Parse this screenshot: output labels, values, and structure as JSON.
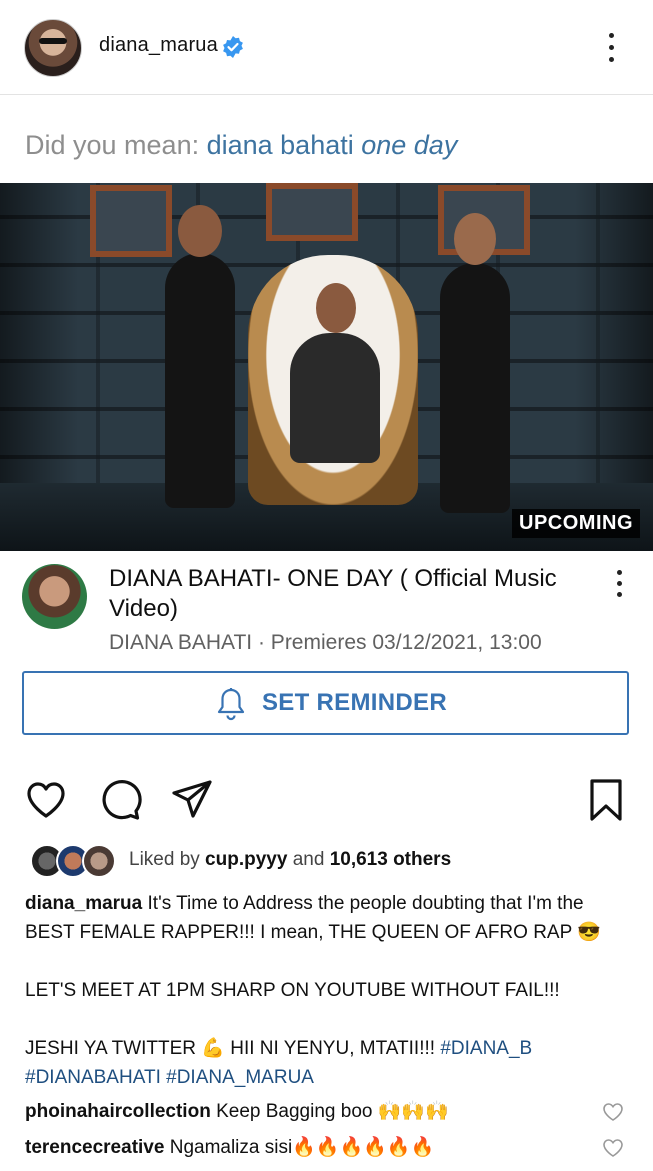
{
  "header": {
    "username": "diana_marua",
    "verified": true
  },
  "did_you_mean": {
    "prefix": "Did you mean: ",
    "query_normal": "diana bahati ",
    "query_italic": "one day"
  },
  "video": {
    "badge": "UPCOMING"
  },
  "youtube": {
    "title": "DIANA BAHATI- ONE DAY ( Official Music Video)",
    "meta": "DIANA BAHATI · Premieres 03/12/2021, 13:00",
    "reminder_label": "SET REMINDER"
  },
  "likes": {
    "prefix": "Liked by ",
    "user": "cup.pyyy",
    "middle": " and ",
    "count": "10,613 others"
  },
  "caption": {
    "username": "diana_marua",
    "line1": " It's Time to Address the people doubting that I'm the BEST FEMALE RAPPER!!! I mean, THE QUEEN OF AFRO RAP 😎",
    "line2": "LET'S MEET AT 1PM SHARP ON YOUTUBE WITHOUT FAIL!!!",
    "line3": "JESHI YA TWITTER 💪 HII NI YENYU, MTATII!!! ",
    "tags": [
      "#DIANA_B",
      "#DIANABAHATI",
      "#DIANA_MARUA"
    ]
  },
  "comments": [
    {
      "user": "phoinahaircollection",
      "text": " Keep Bagging boo 🙌🙌🙌"
    },
    {
      "user": "terencecreative",
      "text": " Ngamaliza sisi🔥🔥🔥🔥🔥🔥"
    }
  ],
  "colors": {
    "link_blue": "#3873b3",
    "hashtag": "#1f4f80",
    "verified_blue": "#3897f0"
  }
}
